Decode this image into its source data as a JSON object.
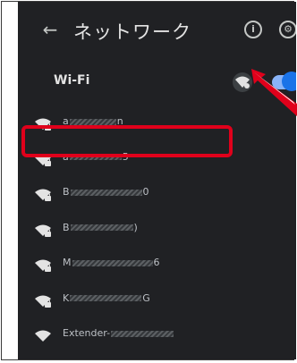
{
  "header": {
    "title": "ネットワーク",
    "back_icon": "arrow-left-icon",
    "info_icon": "info-icon",
    "settings_icon": "gear-icon"
  },
  "wifi": {
    "label": "Wi-Fi",
    "enabled": true
  },
  "networks": [
    {
      "prefix": "a",
      "suffix": "n"
    },
    {
      "prefix": "a",
      "suffix": "5"
    },
    {
      "prefix": "B",
      "suffix": "0"
    },
    {
      "prefix": "B",
      "suffix": ")"
    },
    {
      "prefix": "M",
      "suffix": "6"
    },
    {
      "prefix": "K",
      "suffix": "G"
    },
    {
      "prefix": "Extender-",
      "suffix": ""
    }
  ],
  "colors": {
    "panel": "#202124",
    "accent": "#1a73e8",
    "highlight": "#e0001b"
  }
}
